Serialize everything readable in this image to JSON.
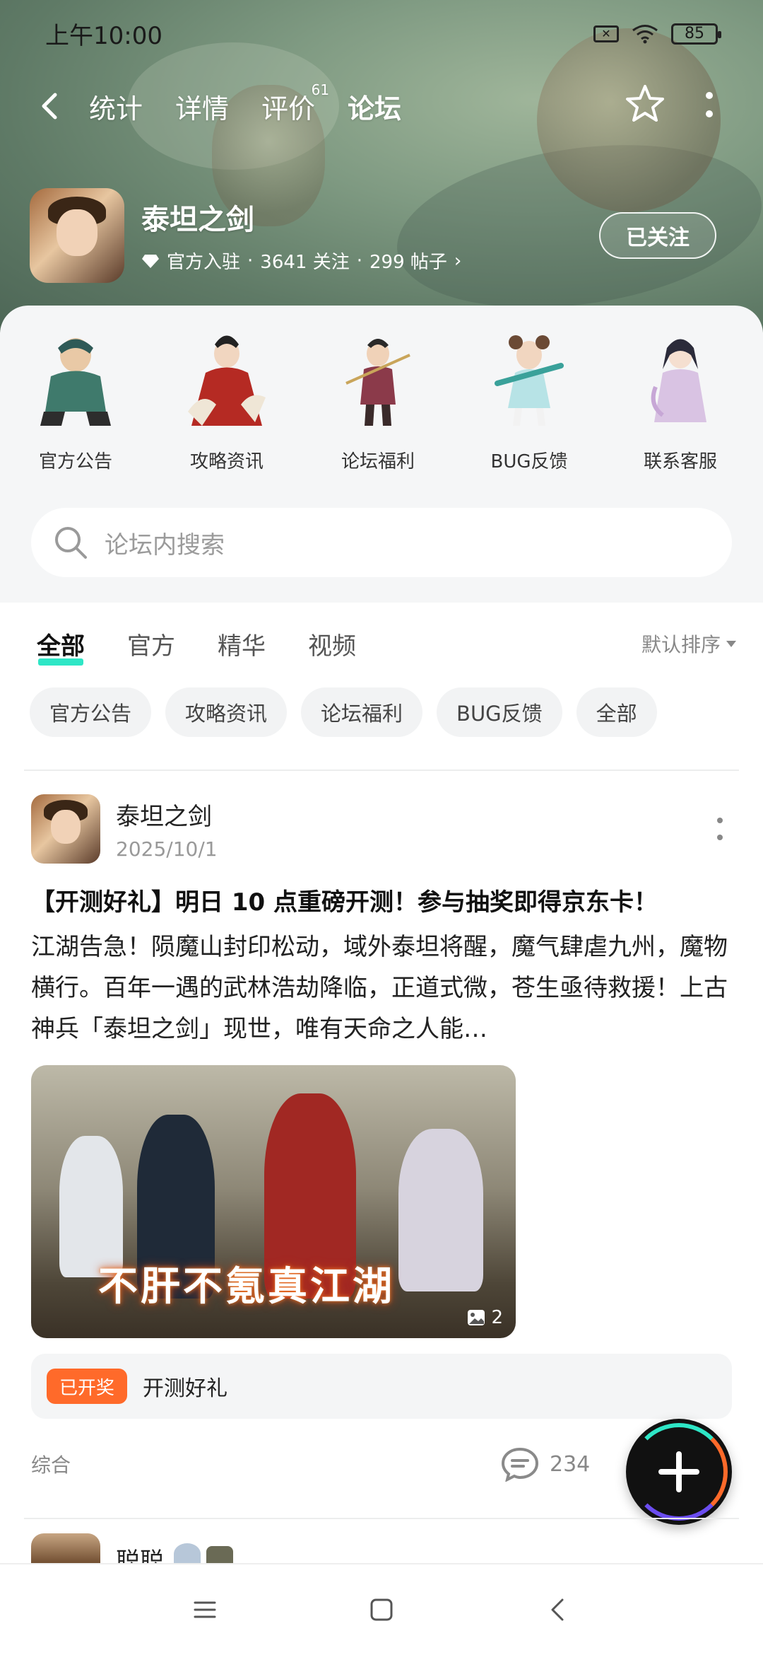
{
  "status_bar": {
    "time": "上午10:00",
    "battery": "85"
  },
  "top_nav": {
    "tabs": [
      {
        "label": "统计"
      },
      {
        "label": "详情"
      },
      {
        "label": "评价",
        "badge": "61"
      },
      {
        "label": "论坛"
      }
    ],
    "active_tab": "论坛"
  },
  "app": {
    "name": "泰坦之剑",
    "official": "官方入驻",
    "followers": "3641 关注",
    "posts": "299 帖子",
    "follow_button": "已关注"
  },
  "categories": [
    {
      "label": "官方公告"
    },
    {
      "label": "攻略资讯"
    },
    {
      "label": "论坛福利"
    },
    {
      "label": "BUG反馈"
    },
    {
      "label": "联系客服"
    }
  ],
  "search": {
    "placeholder": "论坛内搜索"
  },
  "feed_tabs": {
    "tabs": [
      "全部",
      "官方",
      "精华",
      "视频"
    ],
    "active": "全部",
    "sort": "默认排序"
  },
  "chips": [
    "官方公告",
    "攻略资讯",
    "论坛福利",
    "BUG反馈",
    "全部"
  ],
  "post": {
    "author": "泰坦之剑",
    "date": "2025/10/1",
    "title": "【开测好礼】明日 10 点重磅开测！参与抽奖即得京东卡！",
    "body": "江湖告急！陨魔山封印松动，域外泰坦将醒，魔气肆虐九州，魔物横行。百年一遇的武林浩劫降临，正道式微，苍生亟待救援！上古神兵「泰坦之剑」现世，唯有天命之人能…",
    "image_text": "不肝不氪真江湖",
    "image_count": "2",
    "lottery_badge": "已开奖",
    "lottery_title": "开测好礼",
    "category": "综合",
    "comments": "234"
  },
  "next_post": {
    "author": "聪聪"
  },
  "colors": {
    "accent": "#2ee6c6",
    "badge": "#ff6a2a"
  }
}
